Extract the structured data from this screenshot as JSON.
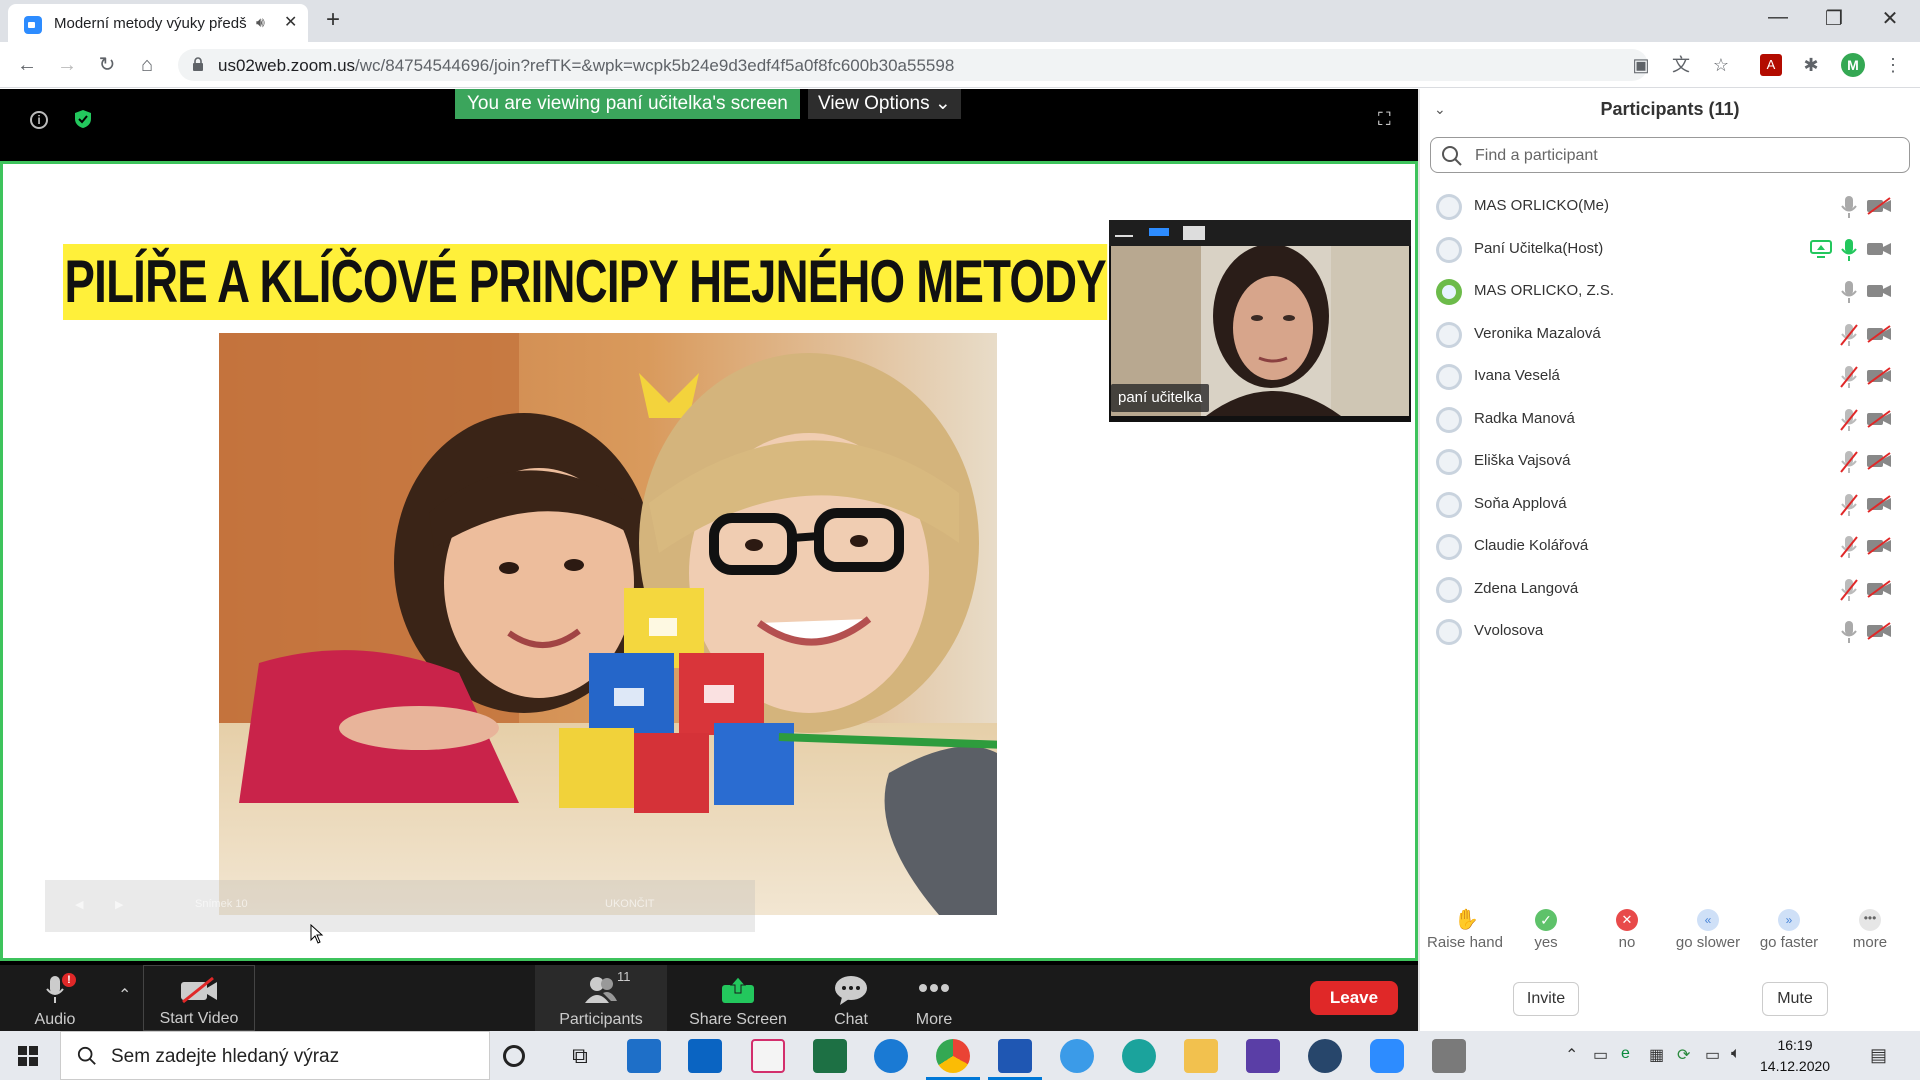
{
  "browser": {
    "tab_title": "Moderní metody výuky předš",
    "url_host": "us02web.zoom.us",
    "url_path": "/wc/84754544696/join?refTK=&wpk=wcpk5b24e9d3edf4f5a0f8fc600b30a55598",
    "profile_initial": "M"
  },
  "meeting": {
    "viewing_banner": "You are viewing paní učitelka's screen",
    "view_options": "View Options",
    "slide_title": "PILÍŘE A KLÍČOVÉ PRINCIPY HEJNÉHO METODY",
    "video_name": "paní učitelka",
    "ppt_toolbar": [
      "Snímek 10",
      "UKONČIT"
    ]
  },
  "toolbar": {
    "audio": "Audio",
    "audio_badge": "!",
    "start_video": "Start Video",
    "participants": "Participants",
    "participants_count": "11",
    "share_screen": "Share Screen",
    "chat": "Chat",
    "more": "More",
    "leave": "Leave"
  },
  "panel": {
    "title": "Participants (11)",
    "search_placeholder": "Find a participant",
    "participants": [
      {
        "name": "MAS ORLICKO(Me)",
        "mic": "on",
        "cam": "off"
      },
      {
        "name": "Paní Učitelka(Host)",
        "mic": "active",
        "cam": "on",
        "sharing": true
      },
      {
        "name": "MAS ORLICKO, Z.S.",
        "mic": "on",
        "cam": "on"
      },
      {
        "name": "Veronika Mazalová",
        "mic": "muted",
        "cam": "off"
      },
      {
        "name": "Ivana Veselá",
        "mic": "muted",
        "cam": "off"
      },
      {
        "name": "Radka Manová",
        "mic": "muted",
        "cam": "off"
      },
      {
        "name": "Eliška Vajsová",
        "mic": "muted",
        "cam": "off"
      },
      {
        "name": "Soňa Applová",
        "mic": "muted",
        "cam": "off"
      },
      {
        "name": "Claudie Kolářová",
        "mic": "muted",
        "cam": "off"
      },
      {
        "name": "Zdena Langová",
        "mic": "muted",
        "cam": "off"
      },
      {
        "name": "Vvolosova",
        "mic": "on",
        "cam": "off"
      }
    ],
    "reactions": [
      "Raise hand",
      "yes",
      "no",
      "go slower",
      "go faster",
      "more"
    ],
    "invite": "Invite",
    "mute": "Mute"
  },
  "taskbar": {
    "search_placeholder": "Sem zadejte hledaný výraz",
    "time": "16:19",
    "date": "14.12.2020"
  },
  "colors": {
    "zoom_green": "#3ec35c",
    "leave_red": "#e02828",
    "title_yellow": "#fff03a",
    "zoom_blue": "#2d8cff"
  }
}
